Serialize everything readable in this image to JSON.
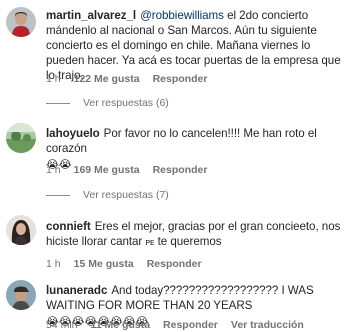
{
  "comments": [
    {
      "username": "martin_alvarez_l",
      "mention": "@robbiewilliams",
      "text": "el 2do concierto mándenlo al nacional o San Marcos. Aún tu siguiente concierto es el domingo en chile. Mañana viernes lo pueden hacer. Ya acá es tocar puertas de la empresa que lo trajo.",
      "time": "1 h",
      "likes": "122 Me gusta",
      "reply": "Responder",
      "view_replies": "Ver respuestas (6)",
      "avatar_icon": "avatar-red-shirt"
    },
    {
      "username": "lahoyuelo",
      "text": "Por favor no lo cancelen!!!! Me han roto el corazón",
      "emoji": "😭😭",
      "time": "1 h",
      "likes": "169 Me gusta",
      "reply": "Responder",
      "view_replies": "Ver respuestas (7)",
      "avatar_icon": "avatar-green-landscape"
    },
    {
      "username": "connieft",
      "text": "Eres el mejor, gracias por el gran concieeto, nos hiciste llorar cantar",
      "small_caps": "ᴘᴇ",
      "text_end": "te queremos",
      "time": "1 h",
      "likes": "15 Me gusta",
      "reply": "Responder",
      "avatar_icon": "avatar-dark-hair-woman"
    },
    {
      "username": "lunaneradc",
      "text": "And today?????????????????? I WAS WAITING FOR MORE THAN 20 YEARS",
      "emoji": "😭😭😭😭😭😭😭😭",
      "time": "54 min",
      "likes": "11 Me gusta",
      "reply": "Responder",
      "translate": "Ver traducción",
      "avatar_icon": "avatar-man-cap"
    }
  ]
}
